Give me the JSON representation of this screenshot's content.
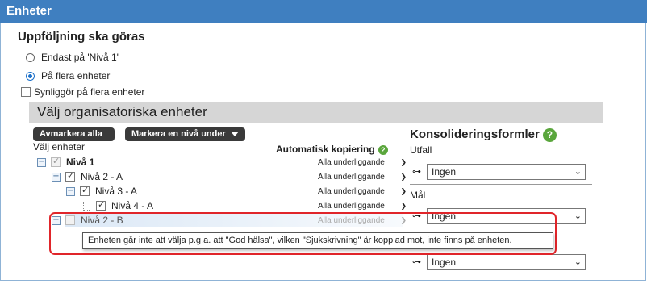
{
  "window": {
    "title": "Enheter"
  },
  "followup": {
    "heading": "Uppföljning ska göras",
    "options": [
      {
        "label": "Endast på 'Nivå 1'",
        "selected": false
      },
      {
        "label": "På flera enheter",
        "selected": true
      }
    ],
    "visible_checkbox_label": "Synliggör på flera enheter",
    "visible_checked": false
  },
  "org_section": {
    "title": "Välj organisatoriska enheter",
    "deselect_all_label": "Avmarkera alla",
    "select_level_label": "Markera en nivå under",
    "choose_units_label": "Välj enheter",
    "auto_copy_label": "Automatisk kopiering",
    "units": [
      {
        "label": "Nivå 1",
        "checked": true,
        "disabled": true,
        "expander": "−",
        "copy": "Alla underliggande",
        "copy_disabled": false
      },
      {
        "label": "Nivå 2 - A",
        "checked": true,
        "disabled": false,
        "expander": "−",
        "copy": "Alla underliggande",
        "copy_disabled": false
      },
      {
        "label": "Nivå 3 - A",
        "checked": true,
        "disabled": false,
        "expander": "−",
        "copy": "Alla underliggande",
        "copy_disabled": false
      },
      {
        "label": "Nivå 4 - A",
        "checked": true,
        "disabled": false,
        "expander": "",
        "copy": "Alla underliggande",
        "copy_disabled": false
      },
      {
        "label": "Nivå 2 - B",
        "checked": false,
        "disabled": true,
        "expander": "+",
        "copy": "Alla underliggande",
        "copy_disabled": true
      }
    ],
    "tooltip": "Enheten går inte att välja p.g.a. att \"God hälsa\", vilken \"Sjukskrivning\" är kopplad mot, inte finns på enheten."
  },
  "consolidation": {
    "title": "Konsolideringsformler",
    "outcome_label": "Utfall",
    "outcome_value": "Ingen",
    "goal_label": "Mål",
    "goal_value": "Ingen",
    "third_value": "Ingen"
  },
  "colors": {
    "titlebar": "#3f7fc0",
    "help_icon": "#5aa63c",
    "highlight_border": "#e0252a"
  }
}
